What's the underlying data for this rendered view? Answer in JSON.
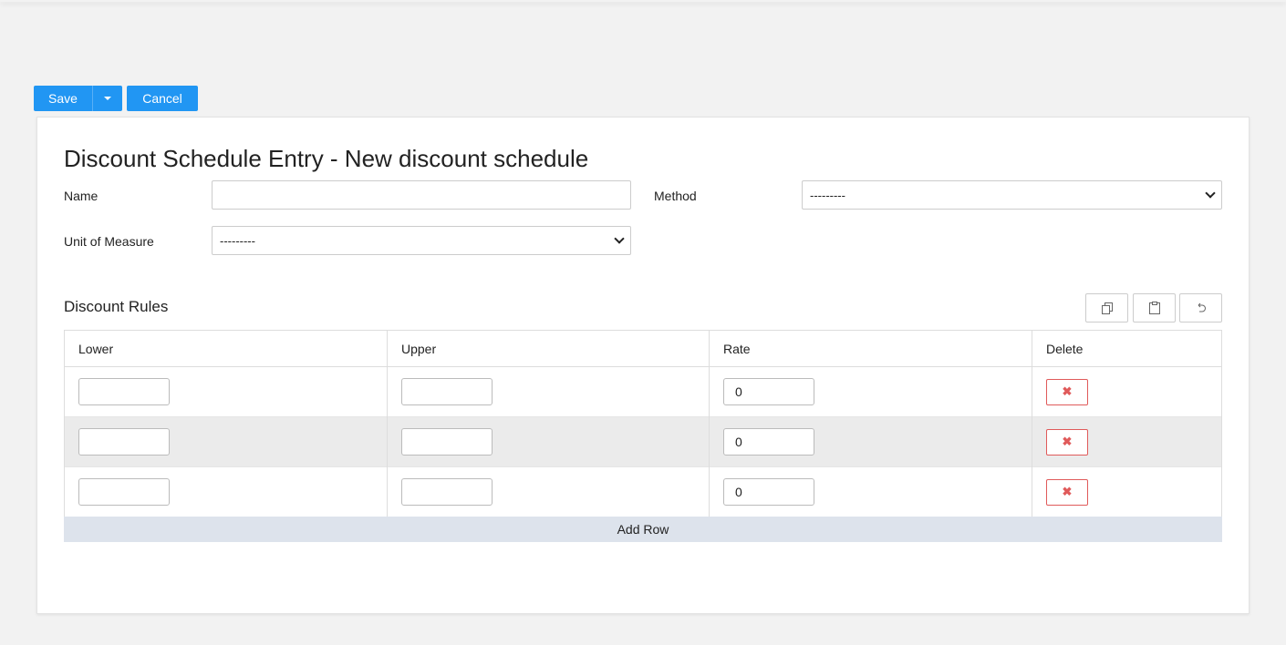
{
  "toolbar": {
    "save_label": "Save",
    "cancel_label": "Cancel",
    "accent": "#2196f3"
  },
  "page": {
    "title": "Discount Schedule Entry - New discount schedule"
  },
  "form": {
    "name_label": "Name",
    "name_value": "",
    "method_label": "Method",
    "method_value": "---------",
    "uom_label": "Unit of Measure",
    "uom_value": "---------"
  },
  "rules": {
    "title": "Discount Rules",
    "icons": [
      "copy-icon",
      "clipboard-icon",
      "undo-icon"
    ],
    "columns": [
      "Lower",
      "Upper",
      "Rate",
      "Delete"
    ],
    "rows": [
      {
        "lower": "",
        "upper": "",
        "rate": "0"
      },
      {
        "lower": "",
        "upper": "",
        "rate": "0"
      },
      {
        "lower": "",
        "upper": "",
        "rate": "0"
      }
    ],
    "delete_glyph": "✖",
    "add_row_label": "Add Row"
  }
}
